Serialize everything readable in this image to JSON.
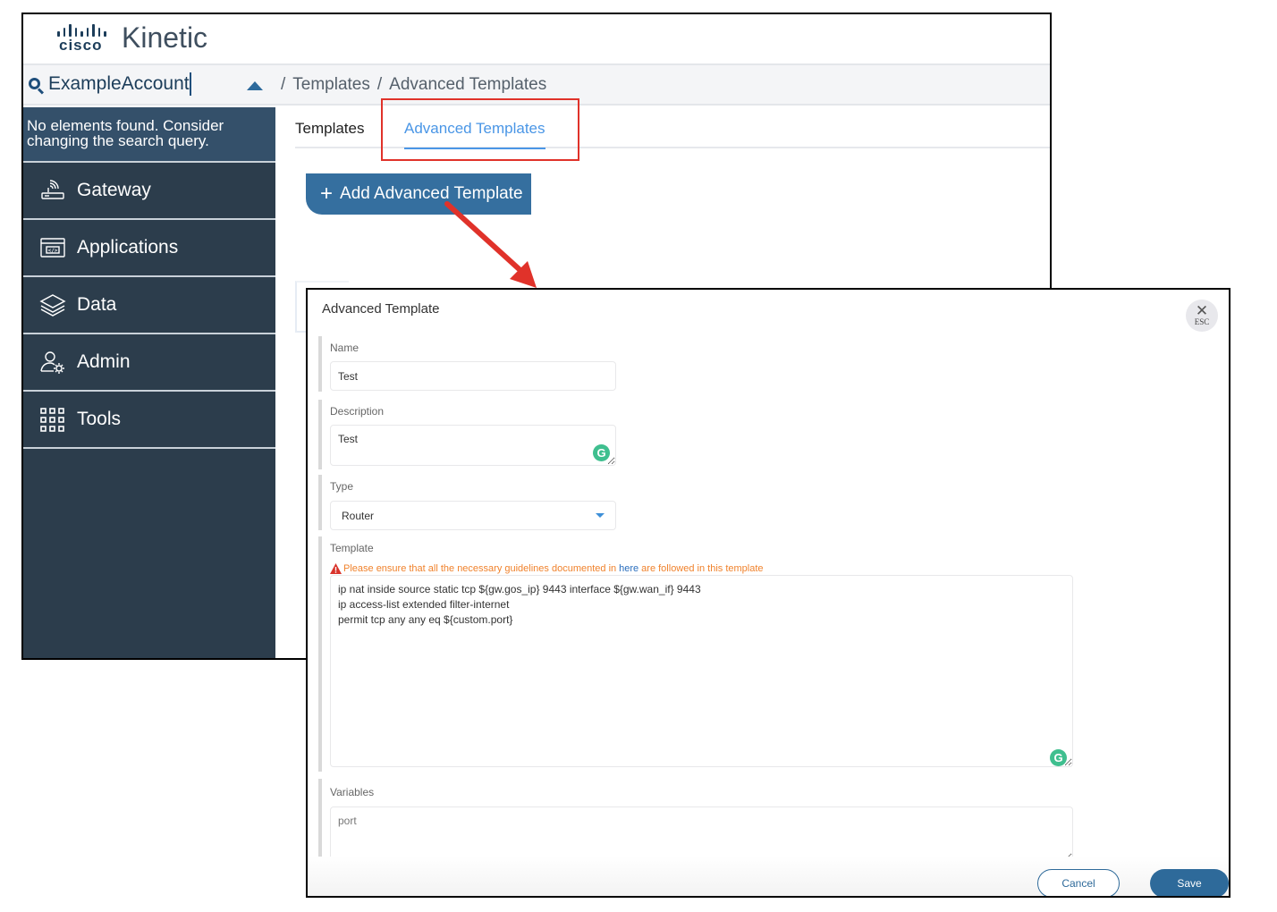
{
  "app": {
    "brand": "cisco",
    "product": "Kinetic",
    "account_search_value": "ExampleAccount",
    "breadcrumb": [
      "Templates",
      "Advanced Templates"
    ]
  },
  "sidebar": {
    "search_message": "No elements found. Consider changing the search query.",
    "items": [
      {
        "label": "Gateway",
        "icon": "router-icon"
      },
      {
        "label": "Applications",
        "icon": "code-window-icon"
      },
      {
        "label": "Data",
        "icon": "layers-icon"
      },
      {
        "label": "Admin",
        "icon": "user-gear-icon"
      },
      {
        "label": "Tools",
        "icon": "grid-icon"
      }
    ]
  },
  "main": {
    "tabs": [
      {
        "label": "Templates",
        "active": false
      },
      {
        "label": "Advanced Templates",
        "active": true
      }
    ],
    "add_button_label": "Add Advanced Template"
  },
  "modal": {
    "title": "Advanced Template",
    "close_label": "ESC",
    "fields": {
      "name": {
        "label": "Name",
        "value": "Test"
      },
      "description": {
        "label": "Description",
        "value": "Test"
      },
      "type": {
        "label": "Type",
        "value": "Router"
      },
      "template": {
        "label": "Template",
        "warning_before": "Please ensure that all the necessary guidelines documented in",
        "warning_link": "here",
        "warning_after": "are followed in this template",
        "value": "ip nat inside source static tcp ${gw.gos_ip} 9443 interface ${gw.wan_if} 9443\nip access-list extended filter-internet\npermit tcp any any eq ${custom.port}"
      },
      "variables": {
        "label": "Variables",
        "value": "port"
      }
    },
    "cancel_label": "Cancel",
    "save_label": "Save"
  },
  "colors": {
    "sidebar_bg": "#2c3d4c",
    "primary": "#356f9f",
    "active_tab": "#4a96e6",
    "warning": "#f0822c",
    "annotation": "#e0322a"
  }
}
